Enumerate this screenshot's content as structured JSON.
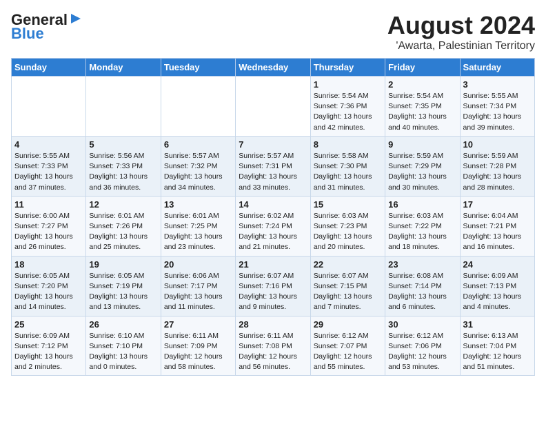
{
  "header": {
    "logo_line1": "General",
    "logo_line2": "Blue",
    "title": "August 2024",
    "subtitle": "'Awarta, Palestinian Territory"
  },
  "calendar": {
    "weekdays": [
      "Sunday",
      "Monday",
      "Tuesday",
      "Wednesday",
      "Thursday",
      "Friday",
      "Saturday"
    ],
    "weeks": [
      [
        {
          "day": "",
          "info": ""
        },
        {
          "day": "",
          "info": ""
        },
        {
          "day": "",
          "info": ""
        },
        {
          "day": "",
          "info": ""
        },
        {
          "day": "1",
          "info": "Sunrise: 5:54 AM\nSunset: 7:36 PM\nDaylight: 13 hours\nand 42 minutes."
        },
        {
          "day": "2",
          "info": "Sunrise: 5:54 AM\nSunset: 7:35 PM\nDaylight: 13 hours\nand 40 minutes."
        },
        {
          "day": "3",
          "info": "Sunrise: 5:55 AM\nSunset: 7:34 PM\nDaylight: 13 hours\nand 39 minutes."
        }
      ],
      [
        {
          "day": "4",
          "info": "Sunrise: 5:55 AM\nSunset: 7:33 PM\nDaylight: 13 hours\nand 37 minutes."
        },
        {
          "day": "5",
          "info": "Sunrise: 5:56 AM\nSunset: 7:33 PM\nDaylight: 13 hours\nand 36 minutes."
        },
        {
          "day": "6",
          "info": "Sunrise: 5:57 AM\nSunset: 7:32 PM\nDaylight: 13 hours\nand 34 minutes."
        },
        {
          "day": "7",
          "info": "Sunrise: 5:57 AM\nSunset: 7:31 PM\nDaylight: 13 hours\nand 33 minutes."
        },
        {
          "day": "8",
          "info": "Sunrise: 5:58 AM\nSunset: 7:30 PM\nDaylight: 13 hours\nand 31 minutes."
        },
        {
          "day": "9",
          "info": "Sunrise: 5:59 AM\nSunset: 7:29 PM\nDaylight: 13 hours\nand 30 minutes."
        },
        {
          "day": "10",
          "info": "Sunrise: 5:59 AM\nSunset: 7:28 PM\nDaylight: 13 hours\nand 28 minutes."
        }
      ],
      [
        {
          "day": "11",
          "info": "Sunrise: 6:00 AM\nSunset: 7:27 PM\nDaylight: 13 hours\nand 26 minutes."
        },
        {
          "day": "12",
          "info": "Sunrise: 6:01 AM\nSunset: 7:26 PM\nDaylight: 13 hours\nand 25 minutes."
        },
        {
          "day": "13",
          "info": "Sunrise: 6:01 AM\nSunset: 7:25 PM\nDaylight: 13 hours\nand 23 minutes."
        },
        {
          "day": "14",
          "info": "Sunrise: 6:02 AM\nSunset: 7:24 PM\nDaylight: 13 hours\nand 21 minutes."
        },
        {
          "day": "15",
          "info": "Sunrise: 6:03 AM\nSunset: 7:23 PM\nDaylight: 13 hours\nand 20 minutes."
        },
        {
          "day": "16",
          "info": "Sunrise: 6:03 AM\nSunset: 7:22 PM\nDaylight: 13 hours\nand 18 minutes."
        },
        {
          "day": "17",
          "info": "Sunrise: 6:04 AM\nSunset: 7:21 PM\nDaylight: 13 hours\nand 16 minutes."
        }
      ],
      [
        {
          "day": "18",
          "info": "Sunrise: 6:05 AM\nSunset: 7:20 PM\nDaylight: 13 hours\nand 14 minutes."
        },
        {
          "day": "19",
          "info": "Sunrise: 6:05 AM\nSunset: 7:19 PM\nDaylight: 13 hours\nand 13 minutes."
        },
        {
          "day": "20",
          "info": "Sunrise: 6:06 AM\nSunset: 7:17 PM\nDaylight: 13 hours\nand 11 minutes."
        },
        {
          "day": "21",
          "info": "Sunrise: 6:07 AM\nSunset: 7:16 PM\nDaylight: 13 hours\nand 9 minutes."
        },
        {
          "day": "22",
          "info": "Sunrise: 6:07 AM\nSunset: 7:15 PM\nDaylight: 13 hours\nand 7 minutes."
        },
        {
          "day": "23",
          "info": "Sunrise: 6:08 AM\nSunset: 7:14 PM\nDaylight: 13 hours\nand 6 minutes."
        },
        {
          "day": "24",
          "info": "Sunrise: 6:09 AM\nSunset: 7:13 PM\nDaylight: 13 hours\nand 4 minutes."
        }
      ],
      [
        {
          "day": "25",
          "info": "Sunrise: 6:09 AM\nSunset: 7:12 PM\nDaylight: 13 hours\nand 2 minutes."
        },
        {
          "day": "26",
          "info": "Sunrise: 6:10 AM\nSunset: 7:10 PM\nDaylight: 13 hours\nand 0 minutes."
        },
        {
          "day": "27",
          "info": "Sunrise: 6:11 AM\nSunset: 7:09 PM\nDaylight: 12 hours\nand 58 minutes."
        },
        {
          "day": "28",
          "info": "Sunrise: 6:11 AM\nSunset: 7:08 PM\nDaylight: 12 hours\nand 56 minutes."
        },
        {
          "day": "29",
          "info": "Sunrise: 6:12 AM\nSunset: 7:07 PM\nDaylight: 12 hours\nand 55 minutes."
        },
        {
          "day": "30",
          "info": "Sunrise: 6:12 AM\nSunset: 7:06 PM\nDaylight: 12 hours\nand 53 minutes."
        },
        {
          "day": "31",
          "info": "Sunrise: 6:13 AM\nSunset: 7:04 PM\nDaylight: 12 hours\nand 51 minutes."
        }
      ]
    ]
  }
}
